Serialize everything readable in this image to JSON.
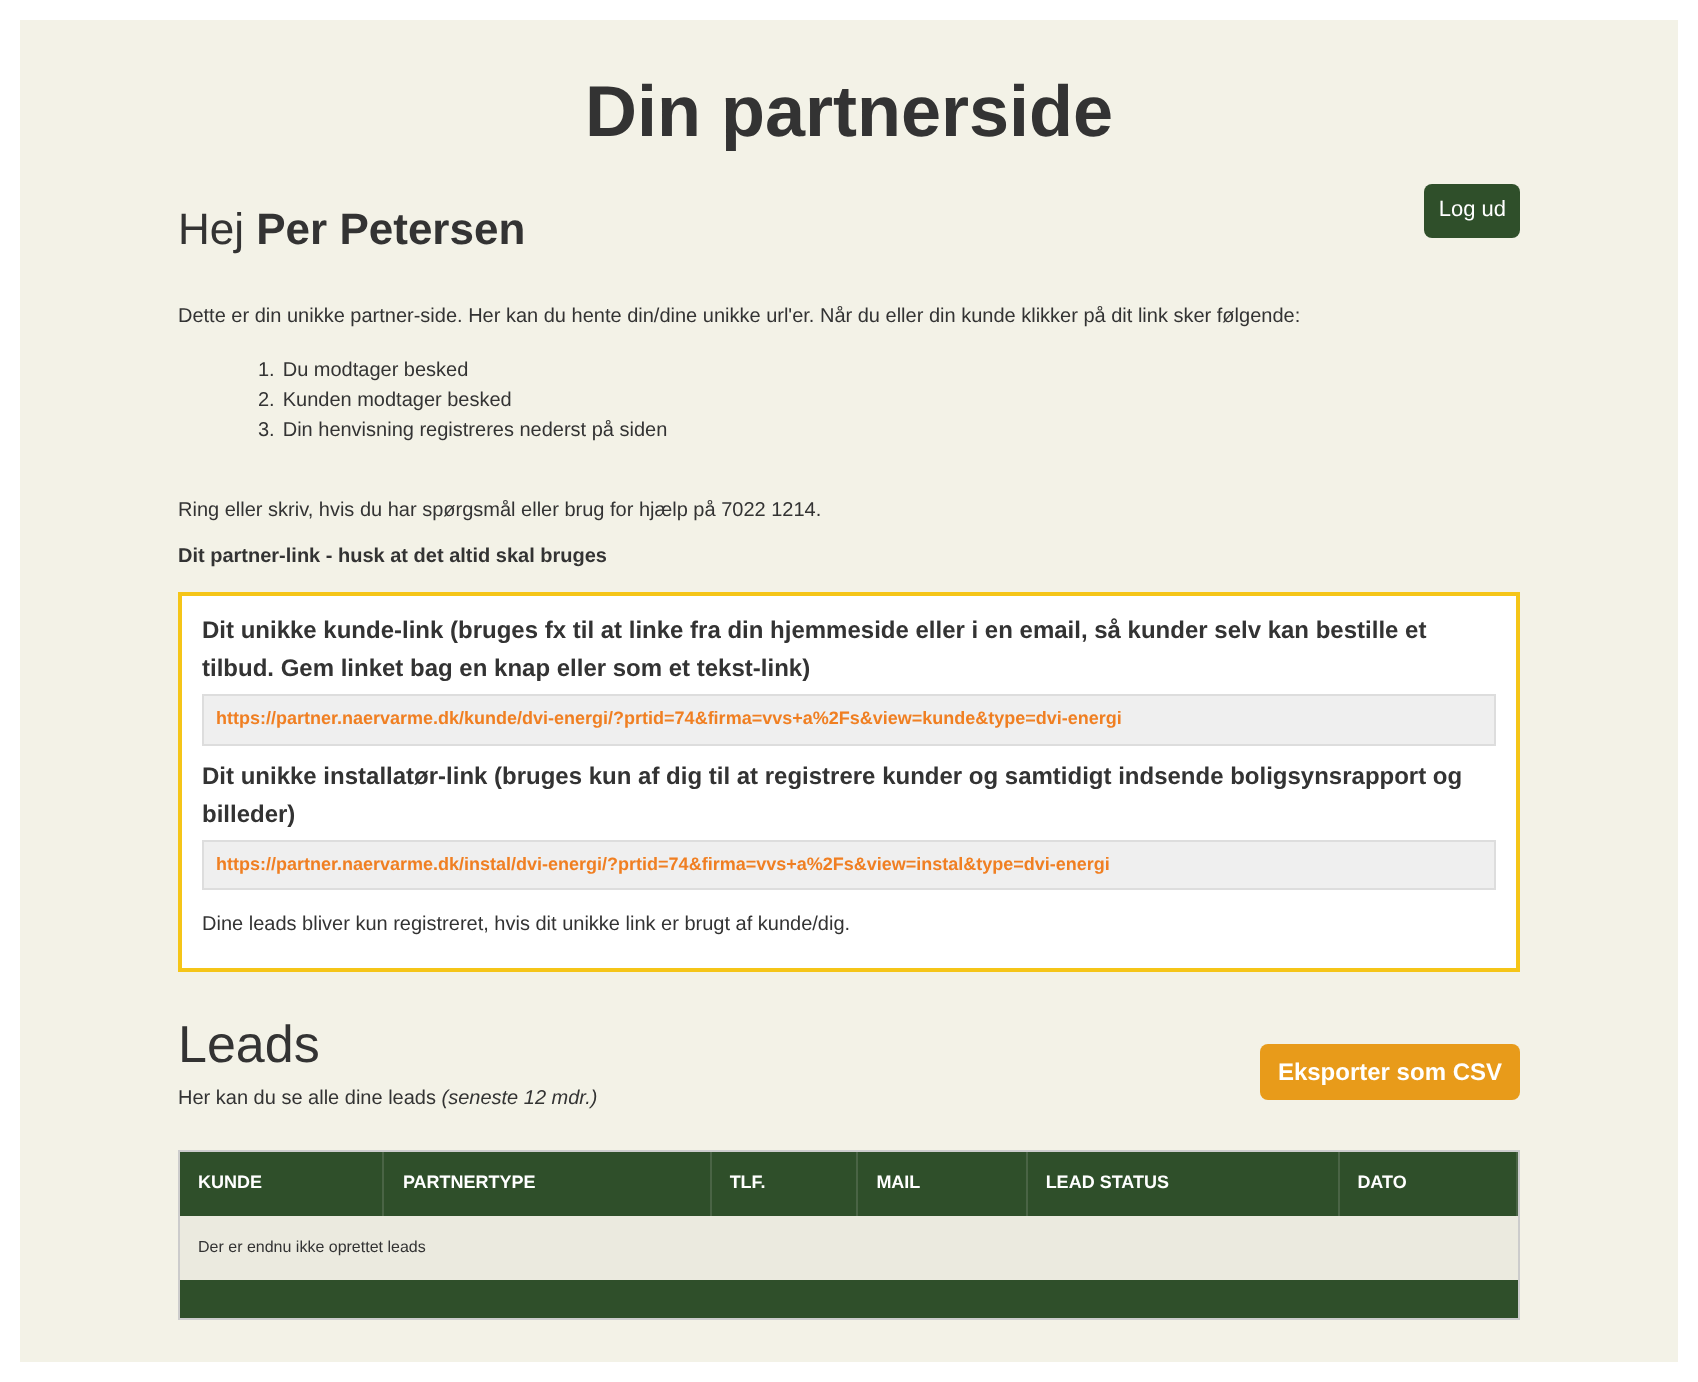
{
  "page_title": "Din partnerside",
  "greeting": "Hej **Per Petersen**",
  "logout_button": "Log ud",
  "intro": "Dette er din unikke partner-side. Her kan du hente din/dine unikke url'er. Når du eller din kunde klikker på dit link sker følgende:",
  "steps": [
    {
      "number": "1.",
      "text": "Du modtager besked"
    },
    {
      "number": "2.",
      "text": "Kunden modtager besked"
    },
    {
      "number": "3.",
      "text": "Din henvisning registreres nederst på siden"
    }
  ],
  "help_text": "Ring eller skriv, hvis du har spørgsmål eller brug for hjælp på 7022 1214.",
  "links_heading": "Dit partner-link - husk at det altid skal bruges",
  "links": [
    {
      "title": "Dit unikke kunde-link (bruges fx til at linke fra din hjemmeside eller i en email, så kunder selv kan bestille et tilbud. Gem linket bag en knap eller som et tekst-link)",
      "url": "https://partner.naervarme.dk/kunde/dvi-energi/?prtid=74&firma=vvs+a%2Fs&view=kunde&type=dvi-energi"
    },
    {
      "title": "Dit unikke installatør-link (bruges kun af dig til at registrere kunder og samtidigt indsende boligsynsrapport og billeder)",
      "url": "https://partner.naervarme.dk/instal/dvi-energi/?prtid=74&firma=vvs+a%2Fs&view=instal&type=dvi-energi"
    }
  ],
  "links_note": "Dine leads bliver kun registreret, hvis dit unikke link er brugt af kunde/dig.",
  "leads": {
    "title": "Leads",
    "subtitle": "Her kan du se alle dine leads *(seneste 12 mdr.)*",
    "export_button": "Eksporter som CSV",
    "table": {
      "columns": [
        "KUNDE",
        "PARTNERTYPE",
        "TLF.",
        "MAIL",
        "LEAD STATUS",
        "DATO"
      ],
      "empty_message": "Der er endnu ikke oprettet leads"
    }
  }
}
